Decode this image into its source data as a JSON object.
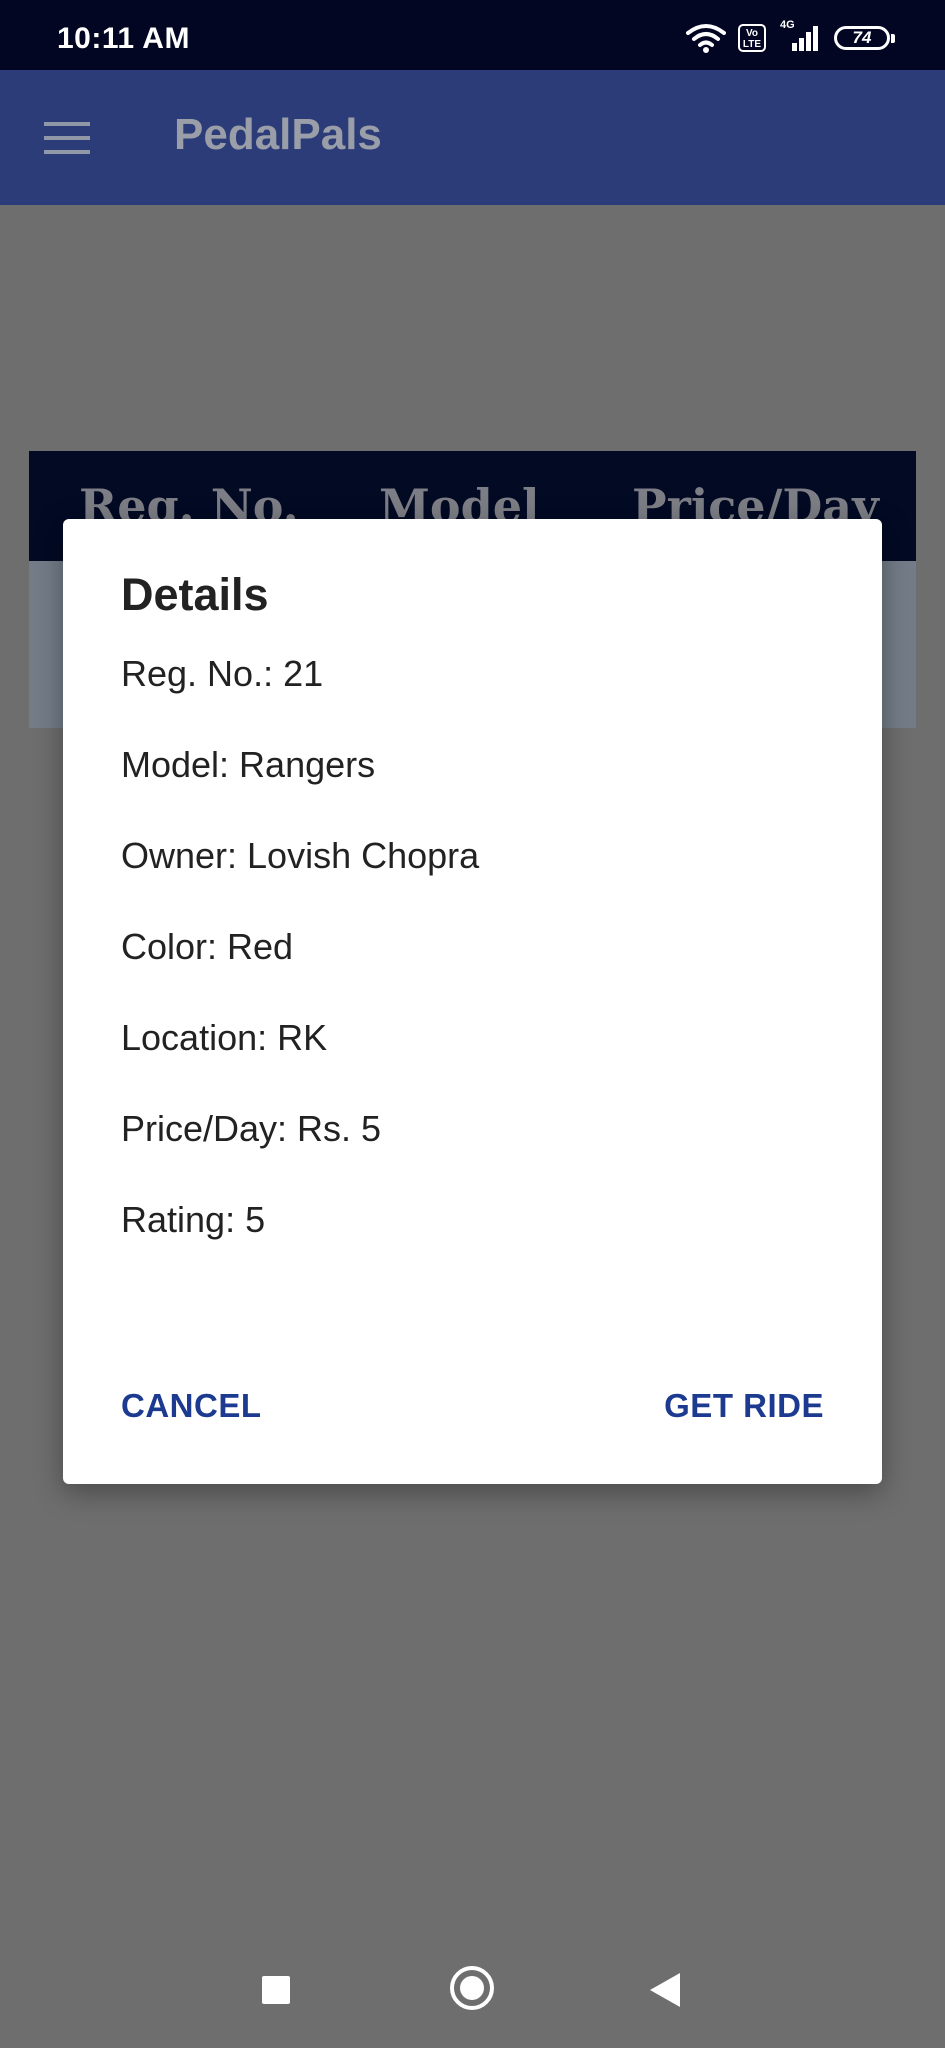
{
  "status_bar": {
    "time": "10:11 AM",
    "volte_label": "Vo\nLTE",
    "network_label": "4G",
    "battery": "74",
    "icons": [
      "wifi-icon",
      "volte-icon",
      "signal-icon",
      "battery-icon"
    ]
  },
  "app_bar": {
    "title": "PedalPals",
    "menu_icon": "hamburger-menu-icon",
    "color": "#3f57b2"
  },
  "table": {
    "headers": [
      "Reg. No.",
      "Model",
      "Price/Day"
    ]
  },
  "dialog": {
    "title": "Details",
    "lines": [
      "Reg. No.: 21",
      "Model: Rangers",
      "Owner: Lovish Chopra",
      "Color: Red",
      "Location: RK",
      "Price/Day: Rs. 5",
      "Rating: 5"
    ],
    "cancel_label": "CANCEL",
    "confirm_label": "GET RIDE",
    "button_color": "#1c3a8f"
  },
  "nav_bar": {
    "icons": [
      "recents-square-icon",
      "home-circle-icon",
      "back-triangle-icon"
    ]
  }
}
